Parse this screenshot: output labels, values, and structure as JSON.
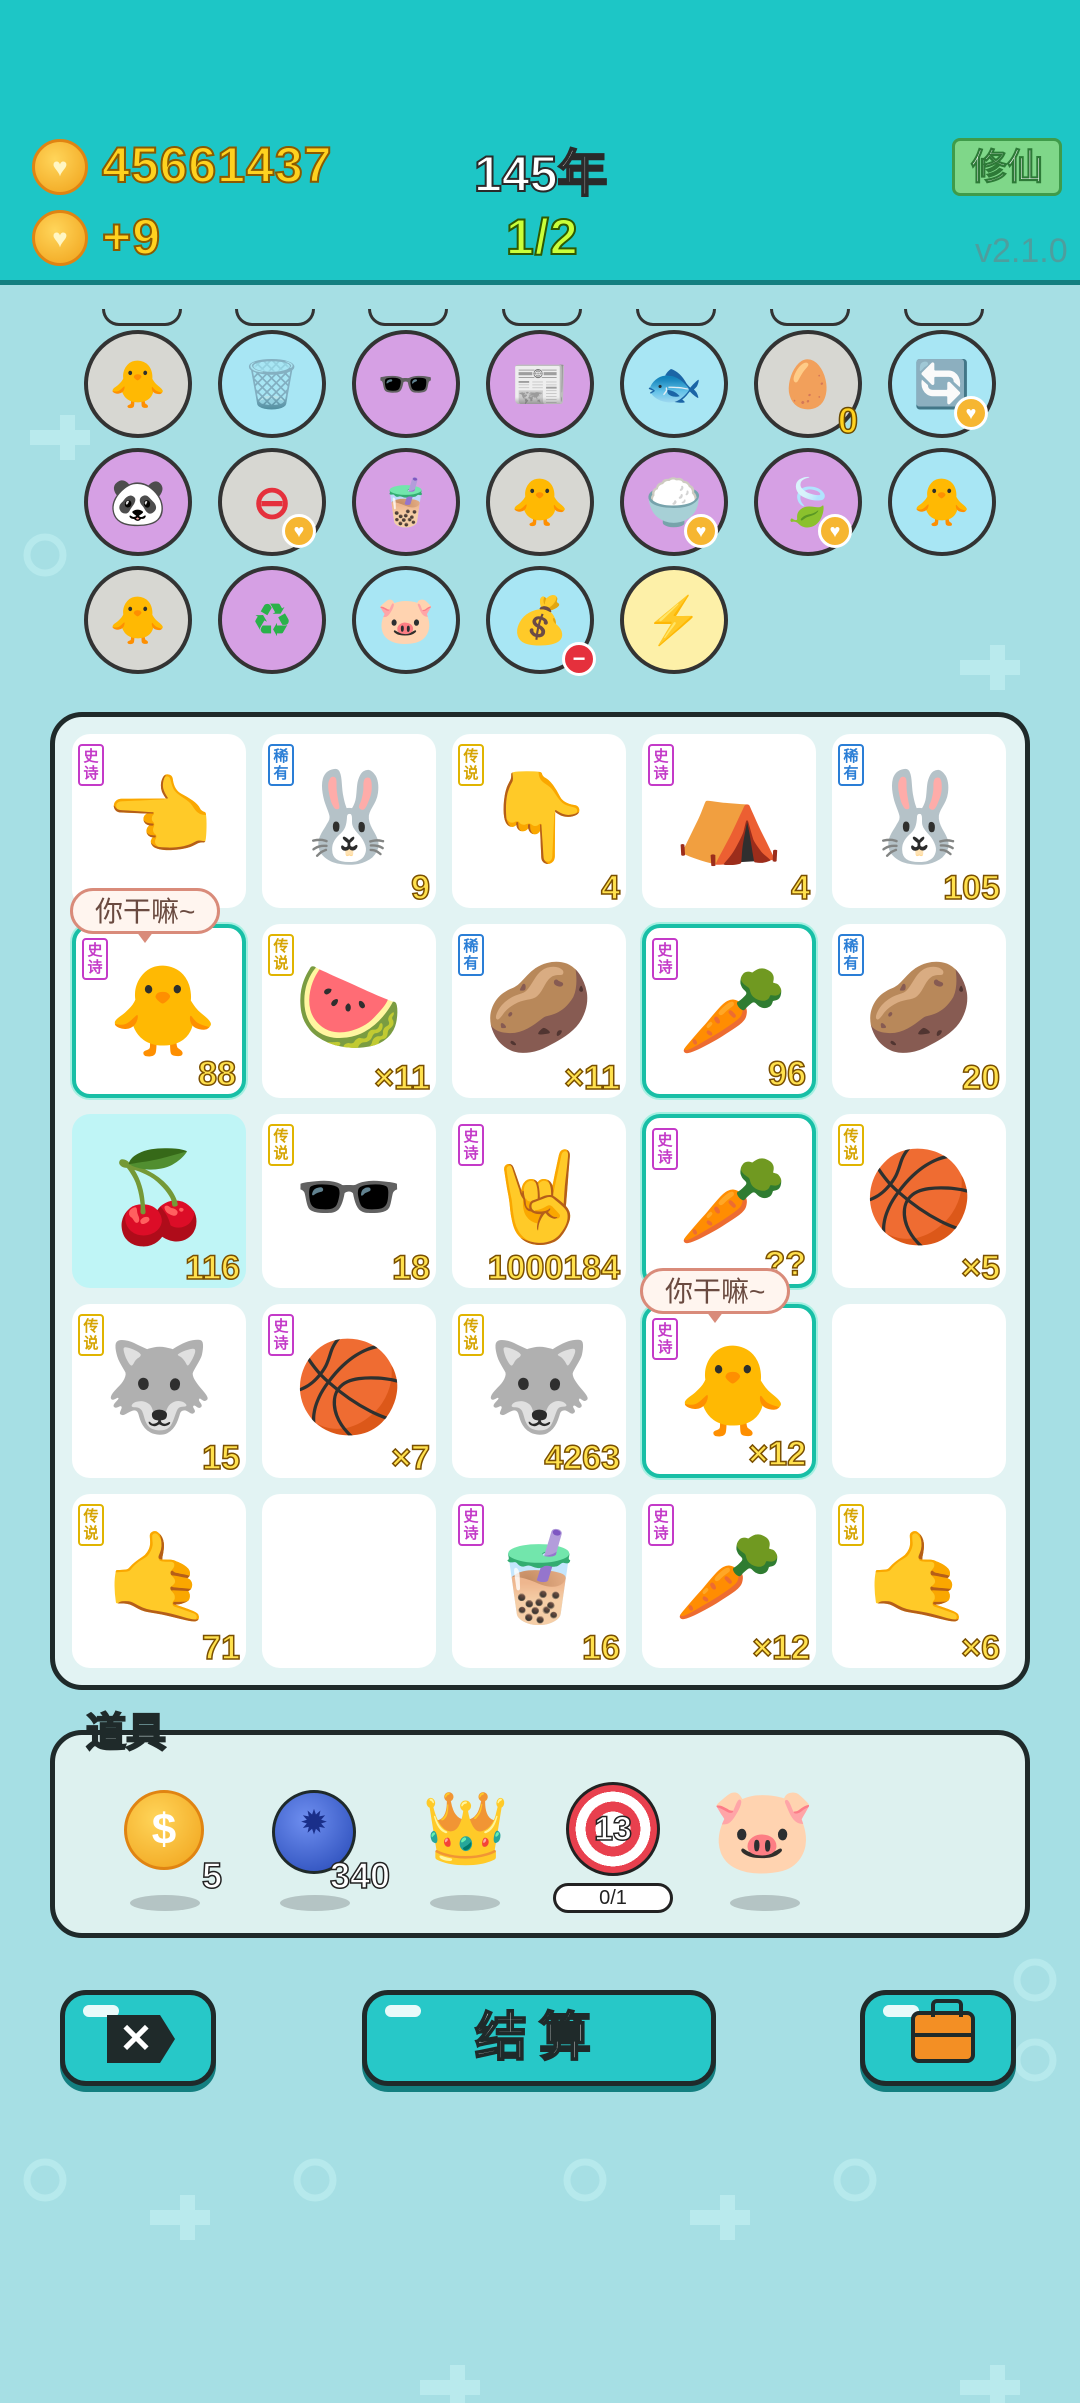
{
  "header": {
    "coins": "45661437",
    "coin_rate": "+9",
    "year": "145年",
    "page": "1/2",
    "xiuxian_label": "修仙",
    "version": "v2.1.0"
  },
  "buffs": {
    "egg_tray_count": "0"
  },
  "bubbles": [
    "你干嘛~",
    "你干嘛~"
  ],
  "grid": [
    {
      "tag": "史诗",
      "icon": "👈",
      "count": ""
    },
    {
      "tag": "稀有",
      "icon": "🐰",
      "count": "9"
    },
    {
      "tag": "传说",
      "icon": "👇",
      "count": "4"
    },
    {
      "tag": "史诗",
      "icon": "⛺",
      "count": "4"
    },
    {
      "tag": "稀有",
      "icon": "🐰",
      "count": "105"
    },
    {
      "tag": "史诗",
      "icon": "🐥",
      "count": "88"
    },
    {
      "tag": "传说",
      "icon": "🍉",
      "count": "×11"
    },
    {
      "tag": "稀有",
      "icon": "🥔",
      "count": "×11"
    },
    {
      "tag": "史诗",
      "icon": "🥕",
      "count": "96"
    },
    {
      "tag": "稀有",
      "icon": "🥔",
      "count": "20"
    },
    {
      "tag": "",
      "icon": "🍒",
      "count": "116"
    },
    {
      "tag": "传说",
      "icon": "🕶️",
      "count": "18"
    },
    {
      "tag": "史诗",
      "icon": "🤘",
      "count": "1000184"
    },
    {
      "tag": "史诗",
      "icon": "🥕",
      "count": "??"
    },
    {
      "tag": "传说",
      "icon": "🏀",
      "count": "×5"
    },
    {
      "tag": "传说",
      "icon": "🐺",
      "count": "15"
    },
    {
      "tag": "史诗",
      "icon": "🏀",
      "count": "×7"
    },
    {
      "tag": "传说",
      "icon": "🐺",
      "count": "4263"
    },
    {
      "tag": "史诗",
      "icon": "🐥",
      "count": "×12"
    },
    {
      "tag": "",
      "icon": "",
      "count": ""
    },
    {
      "tag": "传说",
      "icon": "🤙",
      "count": "71"
    },
    {
      "tag": "",
      "icon": "",
      "count": ""
    },
    {
      "tag": "史诗",
      "icon": "🧋",
      "count": "16"
    },
    {
      "tag": "史诗",
      "icon": "🥕",
      "count": "×12"
    },
    {
      "tag": "传说",
      "icon": "🤙",
      "count": "×6"
    }
  ],
  "props": {
    "title": "道具",
    "coin_count": "5",
    "gem_count": "340",
    "target_number": "13",
    "target_progress": "0/1"
  },
  "buttons": {
    "close_label": "✕",
    "settle_label": "结算"
  },
  "colors": {
    "header_bg": "#1dc6c6",
    "page_bg": "#a6dfe4",
    "gold_text": "#ffd21f",
    "selected_border": "#18bfa6"
  }
}
